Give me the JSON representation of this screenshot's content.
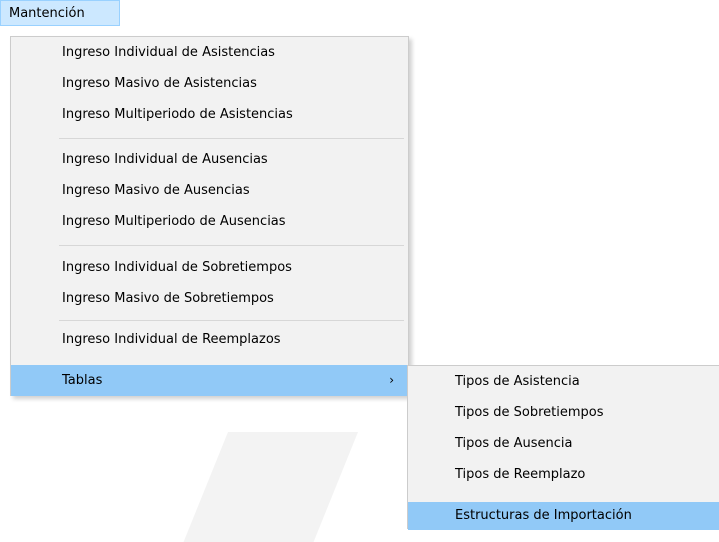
{
  "menubar": {
    "mantencion_label": "Mantención"
  },
  "dropdown": {
    "items": [
      {
        "label": "Ingreso Individual de Asistencias"
      },
      {
        "label": "Ingreso Masivo de Asistencias"
      },
      {
        "label": "Ingreso Multiperiodo de Asistencias"
      },
      {
        "label": "Ingreso Individual de Ausencias"
      },
      {
        "label": "Ingreso Masivo de Ausencias"
      },
      {
        "label": "Ingreso Multiperiodo de Ausencias"
      },
      {
        "label": "Ingreso Individual de Sobretiempos"
      },
      {
        "label": "Ingreso Masivo de Sobretiempos"
      },
      {
        "label": "Ingreso Individual de Reemplazos"
      }
    ],
    "tablas": {
      "label": "Tablas",
      "arrow": "›"
    }
  },
  "submenu": {
    "items": [
      {
        "label": "Tipos de Asistencia"
      },
      {
        "label": "Tipos de Sobretiempos"
      },
      {
        "label": "Tipos de Ausencia"
      },
      {
        "label": "Tipos de Reemplazo"
      },
      {
        "label": "Estructuras de Importación"
      }
    ]
  },
  "colors": {
    "highlight": "#91c9f7",
    "menubar_active": "#cce8ff",
    "menu_bg": "#f2f2f2"
  },
  "icons": {
    "submenu_arrow": "chevron-right-icon"
  }
}
